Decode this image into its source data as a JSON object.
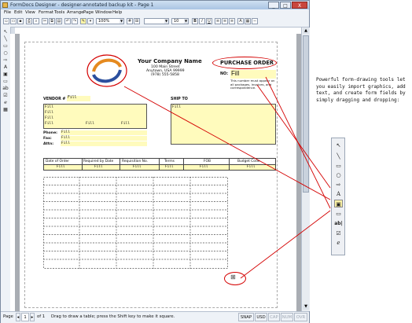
{
  "window": {
    "title": "FormDocs Designer - designer-annotated backup kit - Page 1",
    "btn_minimize": "_",
    "btn_maximize": "□",
    "btn_close": "X"
  },
  "menu": [
    "File",
    "Edit",
    "View",
    "Format",
    "Tools",
    "Arrange",
    "Page",
    "Window",
    "Help"
  ],
  "toolbar": {
    "font_name": "",
    "font_size": "10",
    "zoom": "100%",
    "bold": "B",
    "italic": "I",
    "underline": "U"
  },
  "form": {
    "company_name": "Your Company Name",
    "address1": "100 Main Street",
    "address2": "Anytown, USA 99999",
    "phone": "(978) 555-5858",
    "po_title": "PURCHASE ORDER",
    "no_label": "NO:",
    "no_value": "Fill",
    "po_note": "This number must appear on all packages, invoices, and correspondence.",
    "vendor_label": "VENDOR #",
    "vendor_fill": "Fill",
    "ship_to_label": "SHIP TO",
    "fill": "Fill",
    "phone_label": "Phone:",
    "fax_label": "Fax:",
    "attn_label": "Attn:",
    "columns": [
      "Date of Order",
      "Required by Date",
      "Requisition No.",
      "Terms",
      "FOB",
      "Budget Code"
    ]
  },
  "status": {
    "page_label": "Page",
    "page_num": "1",
    "of_label": "of 1",
    "hint": "Drag to draw a table; press the Shift key to make it square.",
    "snap": "SNAP",
    "unit": "USD",
    "cap": "CAP",
    "num": "NUM",
    "ovr": "OVR"
  },
  "annotation": {
    "text": "Powerful form-drawing tools let you easily import graphics, add text, and create form fields by simply dragging and dropping:"
  },
  "colors": {
    "field_yellow": "#fffbbd",
    "annotation_red": "#d40000",
    "logo_orange": "#e58a1f",
    "logo_blue": "#2b4f9e"
  }
}
